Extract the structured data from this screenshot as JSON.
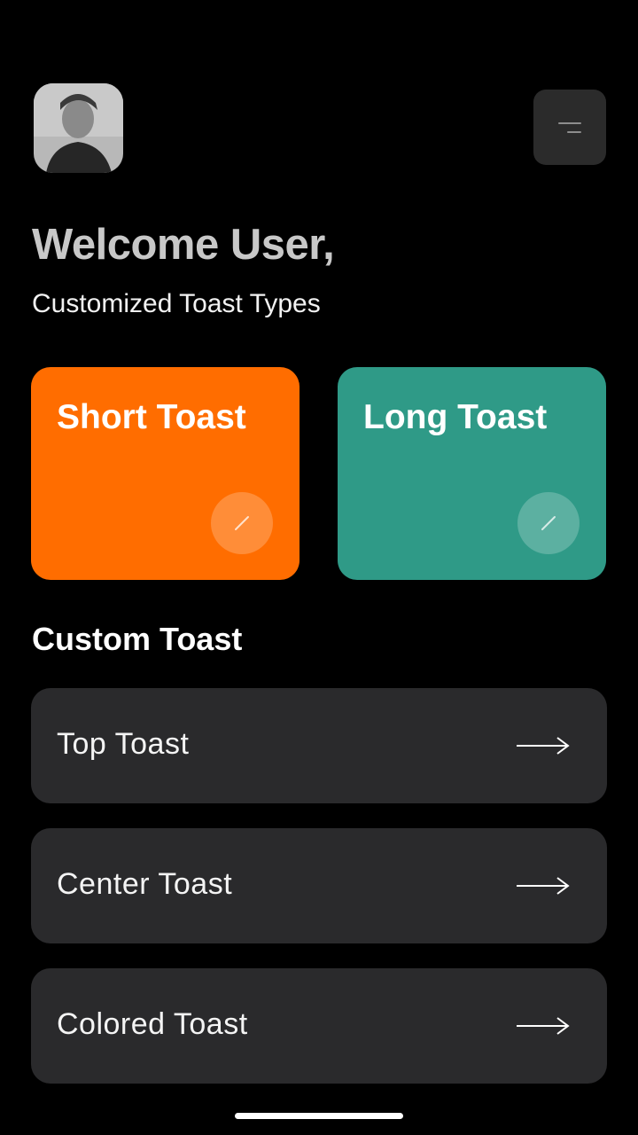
{
  "header": {
    "avatar_alt": "User profile photo",
    "menu_icon": "menu-icon"
  },
  "greeting": {
    "title": "Welcome User,",
    "subtitle": "Customized Toast Types"
  },
  "cards": [
    {
      "label": "Short Toast",
      "color": "#ff6d00",
      "icon": "pencil-icon"
    },
    {
      "label": "Long Toast",
      "color": "#2f9a87",
      "icon": "pencil-icon"
    }
  ],
  "custom_section": {
    "title": "Custom Toast",
    "items": [
      {
        "label": "Top Toast",
        "icon": "arrow-right-icon"
      },
      {
        "label": "Center Toast",
        "icon": "arrow-right-icon"
      },
      {
        "label": "Colored Toast",
        "icon": "arrow-right-icon"
      }
    ]
  }
}
